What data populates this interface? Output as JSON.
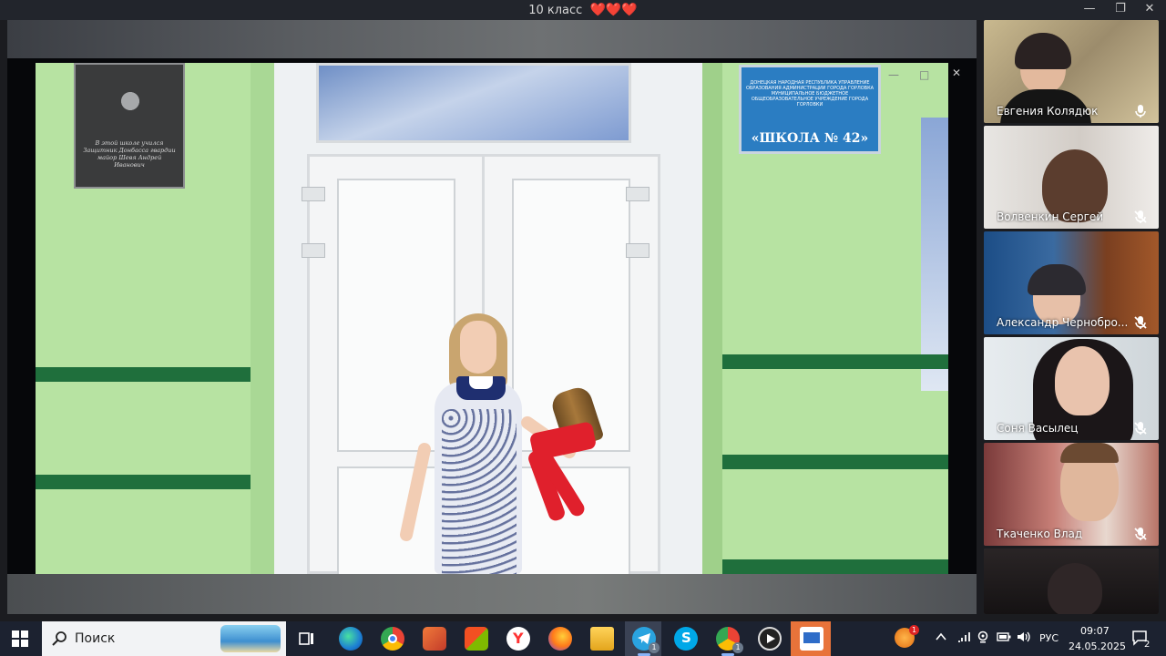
{
  "window": {
    "title": "10 класс",
    "title_emoji": "❤️❤️❤️",
    "controls": {
      "minimize": "—",
      "maximize": "❐",
      "close": "✕"
    }
  },
  "shared_screen": {
    "plaque_text": "В этой школе учился Защитник Донбасса гвардии майор Шевя Андрей Иванович",
    "sign_header": "ДОНЕЦКАЯ НАРОДНАЯ РЕСПУБЛИКА УПРАВЛЕНИЕ ОБРАЗОВАНИЯ АДМИНИСТРАЦИИ ГОРОДА ГОРЛОВКА МУНИЦИПАЛЬНОЕ БЮДЖЕТНОЕ ОБЩЕОБРАЗОВАТЕЛЬНОЕ УЧРЕЖДЕНИЕ ГОРОДА ГОРЛОВКИ",
    "sign_school": "«ШКОЛА № 42»",
    "controls": {
      "minimize": "—",
      "maximize": "□",
      "close": "✕"
    }
  },
  "participants": [
    {
      "name": "Евгения Колядюк",
      "mic": "on",
      "icon": "microphone-icon"
    },
    {
      "name": "Волвенкин Сергей",
      "mic": "muted",
      "icon": "microphone-muted-icon"
    },
    {
      "name": "Александр Чернобро...",
      "mic": "muted",
      "icon": "microphone-muted-icon"
    },
    {
      "name": "Соня Васылец",
      "mic": "muted",
      "icon": "microphone-muted-icon"
    },
    {
      "name": "Ткаченко Влад",
      "mic": "muted",
      "icon": "microphone-muted-icon"
    },
    {
      "name": "",
      "mic": "unknown",
      "icon": ""
    }
  ],
  "taskbar": {
    "search_label": "Поиск",
    "apps": [
      "task-view",
      "edge",
      "chrome",
      "media-player",
      "microsoft-store",
      "yandex-browser",
      "firefox",
      "file-explorer",
      "telegram",
      "skype",
      "chrome-profile",
      "media-player-classic",
      "whiteboard-app"
    ],
    "telegram_badge": "1",
    "chrome_badge": "1",
    "tray_badge": "1",
    "language": "РУС",
    "time": "09:07",
    "date": "24.05.2025",
    "notifications": "2"
  },
  "colors": {
    "accent": "#8ab4f8",
    "heart": "#e2263c",
    "sign_blue": "#2b7dc2",
    "stripe_green": "#1f6f3c"
  }
}
